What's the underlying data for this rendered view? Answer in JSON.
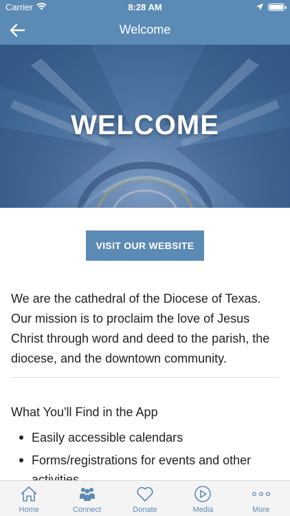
{
  "status_bar": {
    "carrier": "Carrier",
    "time": "8:28 AM"
  },
  "nav": {
    "title": "Welcome",
    "back_icon": "arrow-left-icon"
  },
  "hero": {
    "title": "WELCOME"
  },
  "visit_button": {
    "label": "VISIT OUR WEBSITE"
  },
  "intro_text": "We are the cathedral of the Diocese of Texas. Our mission is to proclaim the love of Jesus Christ through word and deed to the parish, the diocese, and the downtown community.",
  "features": {
    "heading": "What You'll Find in the App",
    "items": [
      "Easily accessible calendars",
      "Forms/registrations for events and other activities"
    ]
  },
  "tab_bar": {
    "tabs": [
      {
        "label": "Home",
        "icon": "home-icon"
      },
      {
        "label": "Connect",
        "icon": "people-icon"
      },
      {
        "label": "Donate",
        "icon": "heart-icon"
      },
      {
        "label": "Media",
        "icon": "play-icon"
      },
      {
        "label": "More",
        "icon": "more-icon"
      }
    ]
  },
  "colors": {
    "brand": "#5b8ab5",
    "text": "#222222"
  }
}
